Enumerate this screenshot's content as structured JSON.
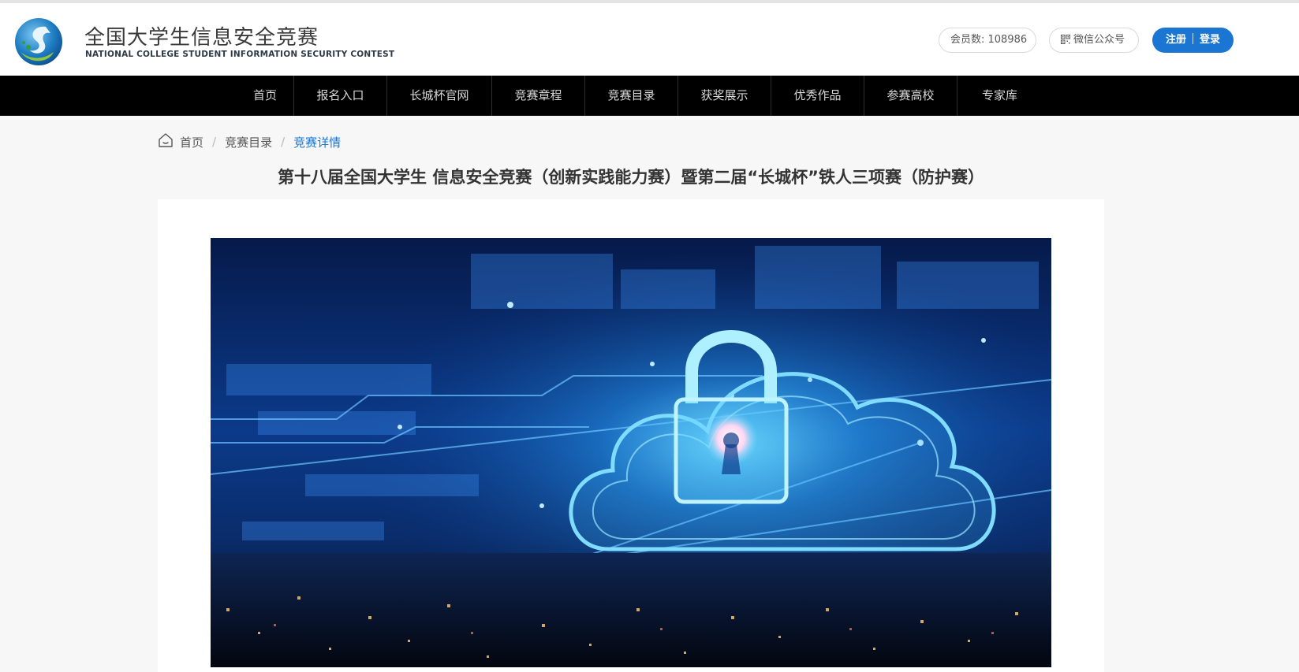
{
  "header": {
    "site_title_cn": "全国大学生信息安全竞赛",
    "site_title_en": "NATIONAL COLLEGE STUDENT INFORMATION SECURITY CONTEST",
    "members_label": "会员数: 108986",
    "wechat_label": "微信公众号",
    "register_label": "注册",
    "login_label": "登录"
  },
  "nav": {
    "items": [
      {
        "label": "首页"
      },
      {
        "label": "报名入口"
      },
      {
        "label": "长城杯官网"
      },
      {
        "label": "竞赛章程"
      },
      {
        "label": "竞赛目录"
      },
      {
        "label": "获奖展示"
      },
      {
        "label": "优秀作品"
      },
      {
        "label": "参赛高校"
      },
      {
        "label": "专家库"
      }
    ]
  },
  "breadcrumb": {
    "home": "首页",
    "catalog": "竞赛目录",
    "current": "竞赛详情"
  },
  "page": {
    "title": "第十八届全国大学生 信息安全竞赛（创新实践能力赛）暨第二届“长城杯”铁人三项赛（防护赛）"
  },
  "colors": {
    "accent": "#1a76d2",
    "nav_bg": "#000000",
    "page_bg": "#f7f7f7"
  },
  "icons": {
    "logo": "contest-logo",
    "wechat": "qr-code-icon",
    "breadcrumb_home": "home-icon",
    "hero": "cloud-lock-security-image"
  }
}
